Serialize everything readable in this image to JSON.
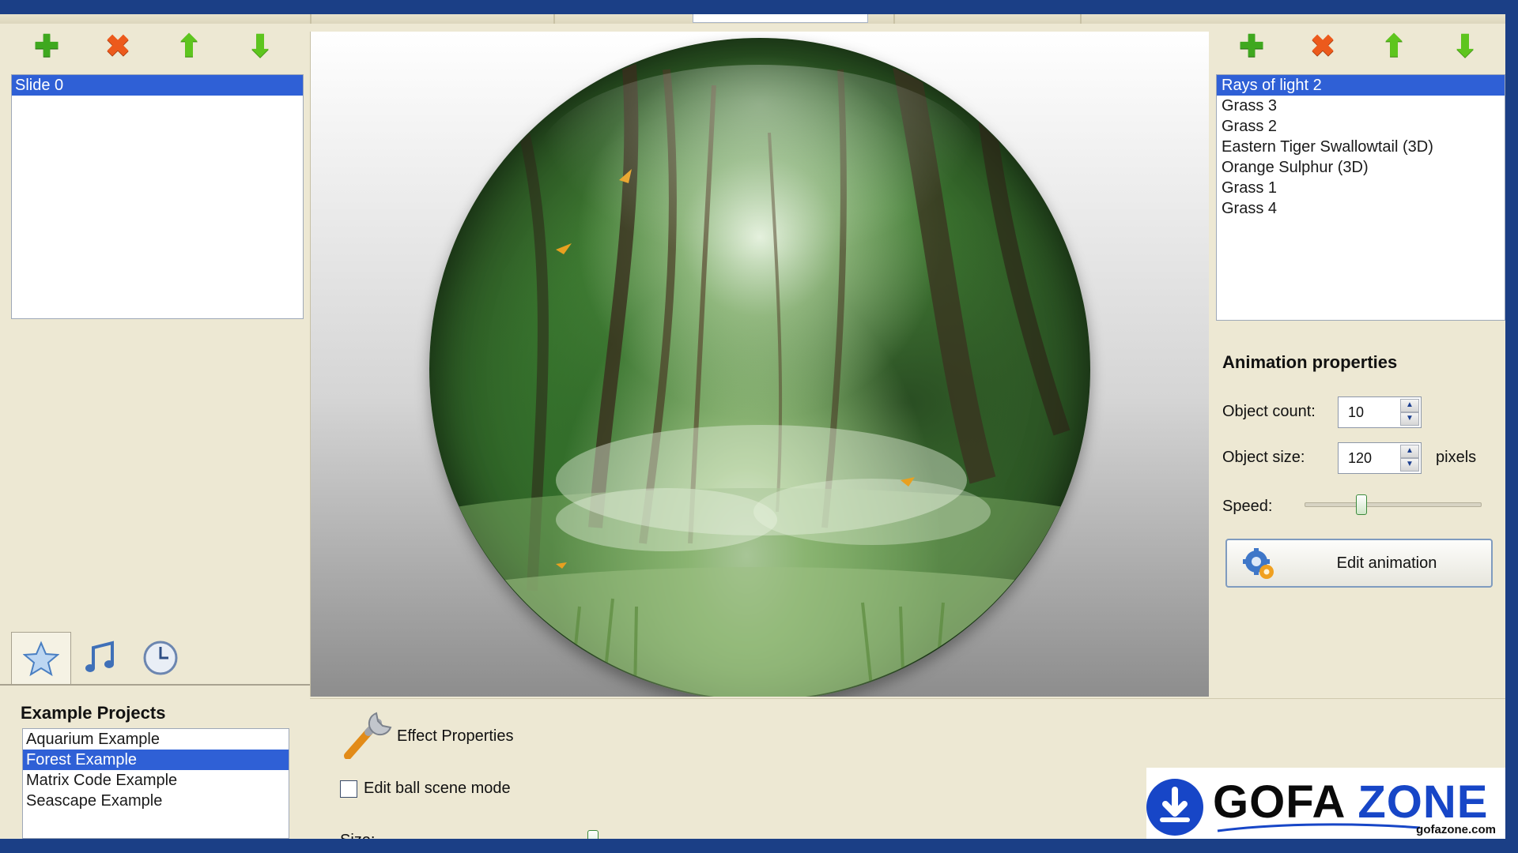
{
  "slides": {
    "items": [
      "Slide 0"
    ],
    "selected_index": 0
  },
  "animations": {
    "items": [
      "Rays of light 2",
      "Grass 3",
      "Grass 2",
      "Eastern Tiger Swallowtail (3D)",
      "Orange Sulphur (3D)",
      "Grass 1",
      "Grass 4"
    ],
    "selected_index": 0
  },
  "animation_properties": {
    "title": "Animation properties",
    "object_count_label": "Object count:",
    "object_count": "10",
    "object_size_label": "Object size:",
    "object_size": "120",
    "object_size_unit": "pixels",
    "speed_label": "Speed:",
    "speed_fraction": 0.32,
    "edit_button_label": "Edit animation"
  },
  "examples": {
    "title": "Example Projects",
    "items": [
      "Aquarium Example",
      "Forest Example",
      "Matrix Code Example",
      "Seascape Example"
    ],
    "selected_index": 1
  },
  "effect": {
    "title": "Effect Properties",
    "edit_mode_label": "Edit ball scene mode",
    "edit_mode_checked": false,
    "size_label": "Size:",
    "size_fraction": 0.98
  },
  "watermark": {
    "brand_part1": "GOFA",
    "brand_part2": "ZONE",
    "domain": "gofazone.com"
  },
  "icons": {
    "add": "plus-icon",
    "delete": "cross-icon",
    "move_up": "arrow-up-icon",
    "move_down": "arrow-down-icon",
    "tab_effects": "star-icon",
    "tab_music": "music-note-icon",
    "tab_timing": "clock-icon"
  },
  "colors": {
    "selection": "#2f60d6",
    "background": "#ede8d3",
    "frame": "#1b3f86"
  }
}
